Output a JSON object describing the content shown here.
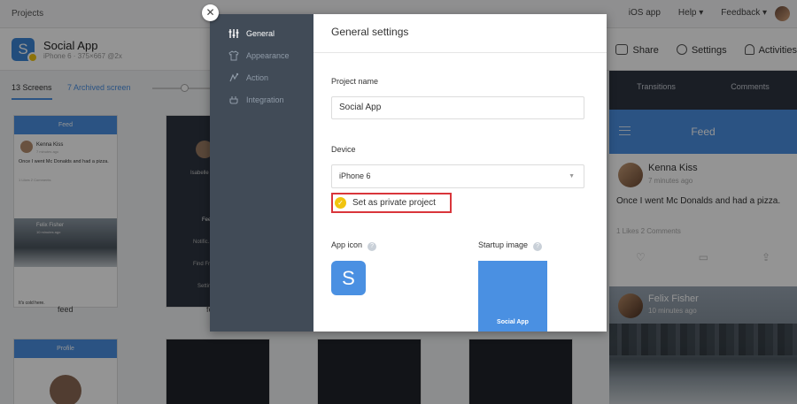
{
  "topbar": {
    "projects_label": "Projects",
    "links": [
      "iOS app",
      "Help ▾",
      "Feedback ▾"
    ]
  },
  "project": {
    "icon_letter": "S",
    "name": "Social App",
    "subtitle": "iPhone 6  ·  375×667 @2x"
  },
  "header_tools": {
    "share": "Share",
    "settings": "Settings",
    "activities": "Activities"
  },
  "screens_tabs": {
    "screens": "13 Screens",
    "archived": "7 Archived screen"
  },
  "cards": [
    {
      "title": "Feed",
      "label": "feed"
    },
    {
      "label": "fe"
    },
    {
      "title": "Profile"
    }
  ],
  "feed_card": {
    "user1": "Kenna Kiss",
    "time1": "7 minutes ago",
    "text1": "Once I went Mc Donalds and had a pizza.",
    "meta1": "1 Likes  2 Comments",
    "user2": "Felix Fisher",
    "time2": "10 minutes ago",
    "text2": "It's cold here."
  },
  "dark_card": {
    "name": "Isabelle",
    "items": [
      "Feed",
      "Notific...",
      "Find Fr...",
      "Settin..."
    ]
  },
  "right_panel": {
    "tabs": [
      "Transitions",
      "Comments"
    ],
    "header": "Feed",
    "post": {
      "author": "Kenna Kiss",
      "time": "7 minutes ago",
      "text": "Once I went Mc Donalds and had a pizza.",
      "meta": "1 Likes   2 Comments"
    },
    "photo_post": {
      "author": "Felix Fisher",
      "time": "10 minutes ago"
    }
  },
  "modal": {
    "close_glyph": "✕",
    "nav": [
      {
        "label": "General",
        "active": true
      },
      {
        "label": "Appearance",
        "active": false
      },
      {
        "label": "Action",
        "active": false
      },
      {
        "label": "Integration",
        "active": false
      }
    ],
    "title": "General settings",
    "project_name_label": "Project name",
    "project_name_value": "Social App",
    "device_label": "Device",
    "device_value": "iPhone 6",
    "private_label": "Set as private project",
    "private_checked": true,
    "app_icon_label": "App icon",
    "app_icon_letter": "S",
    "startup_label": "Startup image",
    "startup_text": "Social App",
    "help_glyph": "?"
  },
  "colors": {
    "accent": "#4a90e2",
    "sidebar": "#414b57",
    "check": "#f1c40f",
    "highlight": "#d9353b"
  }
}
